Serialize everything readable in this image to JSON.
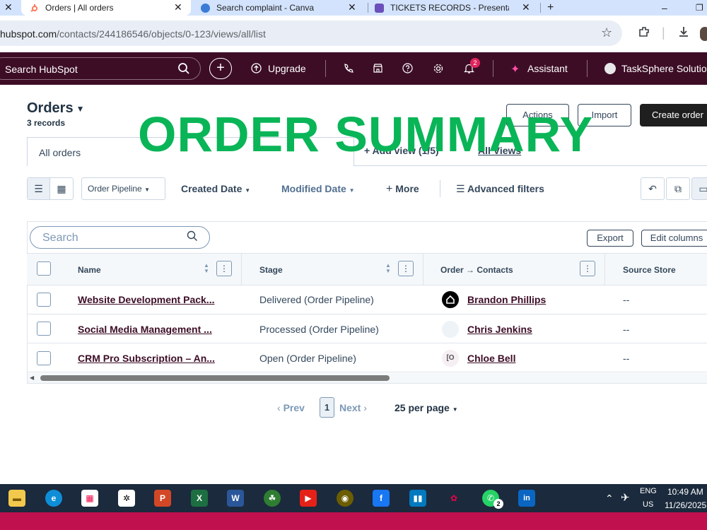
{
  "browser": {
    "tabs": [
      {
        "title": "Orders | All orders"
      },
      {
        "title": "Search complaint - Canva"
      },
      {
        "title": "TICKETS RECORDS - Presentatio"
      }
    ],
    "url_host": "hubspot.com",
    "url_path": "/contacts/244186546/objects/0-123/views/all/list"
  },
  "nav": {
    "search_placeholder": "Search HubSpot",
    "upgrade": "Upgrade",
    "notifications_count": "2",
    "assistant": "Assistant",
    "account": "TaskSphere Solutio"
  },
  "header": {
    "title": "Orders",
    "record_count": "3 records",
    "actions_label": "Actions",
    "import_label": "Import",
    "create_label": "Create order",
    "overlay_text": "ORDER SUMMARY"
  },
  "view_tabs": {
    "active": "All orders",
    "add_view": "+ Add view (1/5)",
    "all_views": "All Views"
  },
  "filters": {
    "pipeline": "Order Pipeline",
    "created_date": "Created Date",
    "modified_date": "Modified Date",
    "more": "More",
    "advanced": "Advanced filters"
  },
  "table": {
    "search_placeholder": "Search",
    "export_label": "Export",
    "edit_columns_label": "Edit columns",
    "columns": [
      "Name",
      "Stage",
      "Order → Contacts",
      "Source Store"
    ],
    "rows": [
      {
        "name": "Website Development Pack...",
        "stage": "Delivered (Order Pipeline)",
        "contact": "Brandon Phillips",
        "source": "--"
      },
      {
        "name": "Social Media Management ...",
        "stage": "Processed (Order Pipeline)",
        "contact": "Chris Jenkins",
        "source": "--"
      },
      {
        "name": "CRM Pro Subscription – An...",
        "stage": "Open (Order Pipeline)",
        "contact": "Chloe Bell",
        "source": "--"
      }
    ]
  },
  "pagination": {
    "prev": "Prev",
    "page": "1",
    "next": "Next",
    "per_page": "25 per page"
  },
  "taskbar": {
    "lang": "ENG",
    "region": "US",
    "time": "10:49 AM",
    "date": "11/26/2025",
    "whatsapp_badge": "2"
  },
  "colors": {
    "nav_bg": "#3d0d26",
    "overlay_green": "#09b557",
    "link_color": "#3d0d26",
    "taskbar_bg": "#1b2a3d",
    "bottom_bar": "#c0104e"
  }
}
